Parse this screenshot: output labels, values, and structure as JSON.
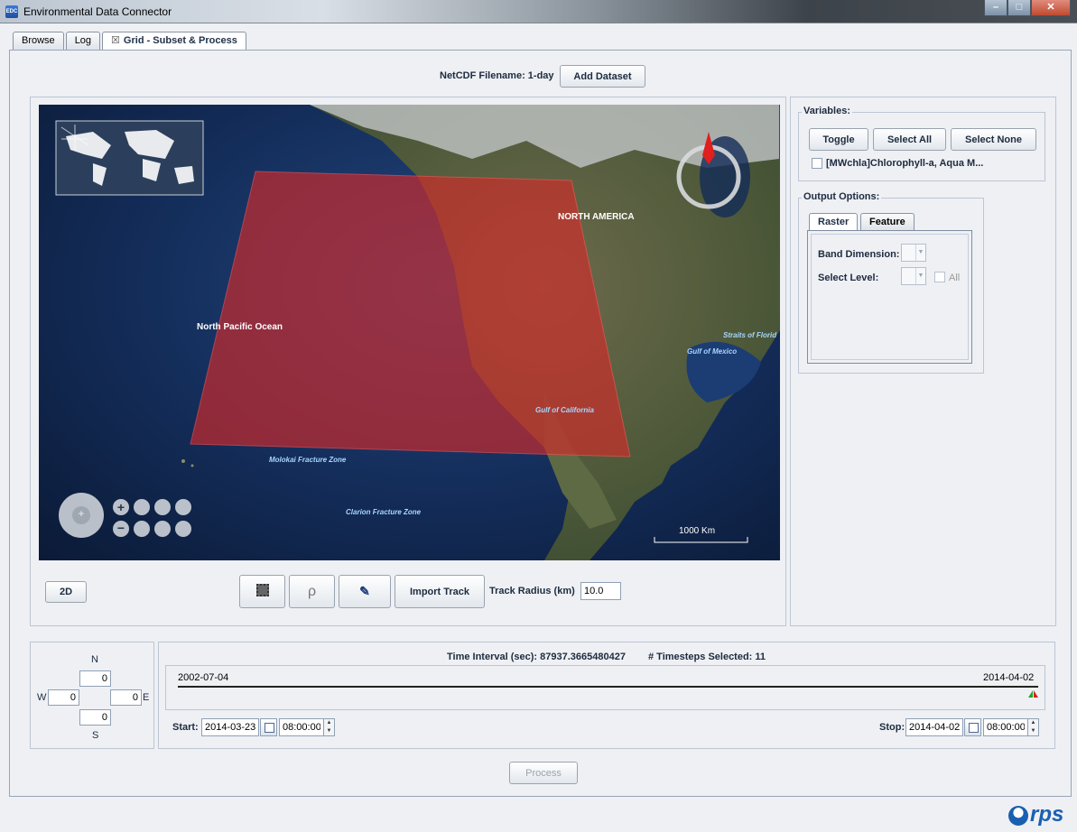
{
  "window": {
    "title": "Environmental Data Connector",
    "icon_text": "EDC",
    "minimize": "–",
    "maximize": "□",
    "close": "✕"
  },
  "tabs": [
    {
      "label": "Browse"
    },
    {
      "label": "Log"
    },
    {
      "label": "Grid - Subset & Process",
      "close_glyph": "☒"
    }
  ],
  "dataset": {
    "filename_label": "NetCDF Filename: 1-day",
    "add_button": "Add Dataset"
  },
  "map": {
    "labels": {
      "north_america": "NORTH AMERICA",
      "north_pacific": "North Pacific Ocean",
      "gulf_california": "Gulf of California",
      "gulf_mexico": "Gulf of Mexico",
      "straits_florida": "Straits of Florid",
      "molokai": "Molokai Fracture Zone",
      "clarion": "Clarion Fracture Zone"
    },
    "scale_label": "1000 Km",
    "selection_color": "#d42a2a"
  },
  "map_tools": {
    "view_toggle": "2D",
    "import_track": "Import Track",
    "track_radius_label": "Track Radius (km)",
    "track_radius_value": "10.0",
    "tool_icons": [
      "rectangle-select-icon",
      "lasso-select-icon",
      "eraser-icon"
    ]
  },
  "variables": {
    "group_label": "Variables:",
    "toggle": "Toggle",
    "select_all": "Select All",
    "select_none": "Select None",
    "items": [
      {
        "label": "[MWchla]Chlorophyll-a, Aqua M...",
        "checked": false
      }
    ]
  },
  "output_options": {
    "group_label": "Output Options:",
    "tabs": [
      "Raster",
      "Feature"
    ],
    "band_dimension_label": "Band Dimension:",
    "select_level_label": "Select Level:",
    "all_label": "All"
  },
  "bounds": {
    "n_label": "N",
    "s_label": "S",
    "w_label": "W",
    "e_label": "E",
    "north": "0",
    "south": "0",
    "west": "0",
    "east": "0"
  },
  "time": {
    "interval_text": "Time Interval (sec): 87937.3665480427",
    "timesteps_text": "# Timesteps Selected: 11",
    "range_start": "2002-07-04",
    "range_end": "2014-04-02",
    "start_label": "Start:",
    "start_date": "2014-03-23",
    "start_time": "08:00:00",
    "stop_label": "Stop:",
    "stop_date": "2014-04-02",
    "stop_time": "08:00:00"
  },
  "process_button": "Process",
  "logo": {
    "text": "rps"
  }
}
